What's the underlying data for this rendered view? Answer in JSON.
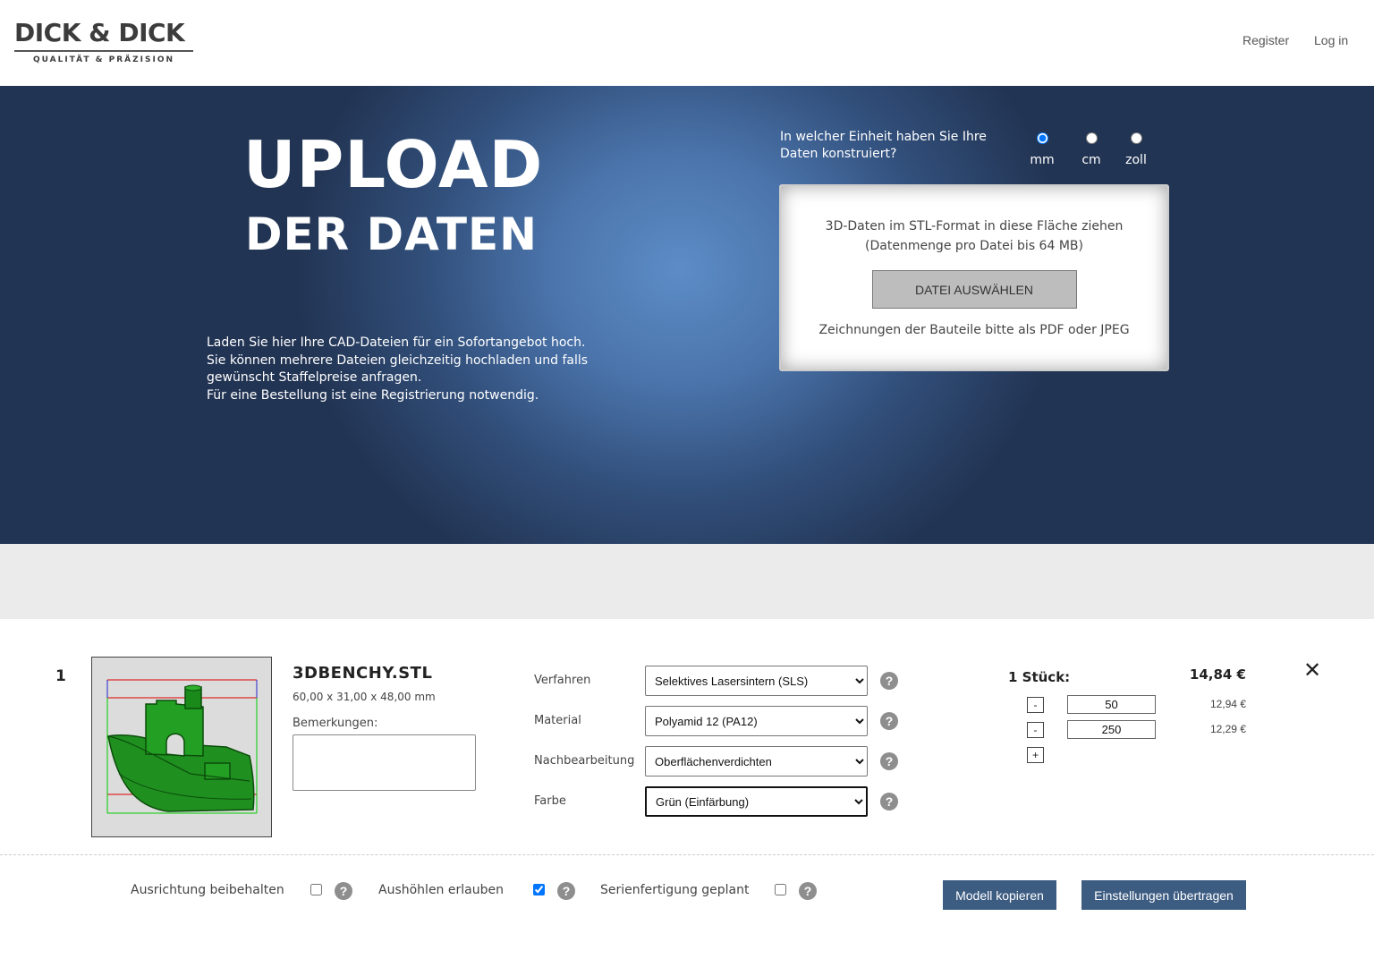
{
  "header": {
    "logo_main": "DICK & DICK",
    "logo_sub": "QUALITÄT & PRÄZISION",
    "nav": {
      "register": "Register",
      "login": "Log in"
    }
  },
  "hero": {
    "title": "UPLOAD",
    "subtitle": "DER DATEN",
    "intro": [
      "Laden Sie hier Ihre CAD-Dateien für ein Sofortangebot hoch.",
      "Sie können mehrere Dateien gleichzeitig hochladen und falls",
      "gewünscht Staffelpreise anfragen.",
      "Für eine Bestellung ist eine Registrierung notwendig."
    ],
    "unit_question": "In welcher Einheit haben Sie Ihre Daten konstruiert?",
    "units": [
      "mm",
      "cm",
      "zoll"
    ],
    "selected_unit": "mm",
    "upload": {
      "line1": "3D-Daten im STL-Format in diese Fläche ziehen",
      "line2": "(Datenmenge pro Datei bis 64 MB)",
      "button": "DATEI AUSWÄHLEN",
      "note": "Zeichnungen der Bauteile bitte als PDF oder JPEG"
    }
  },
  "item": {
    "number": "1",
    "file_name": "3DBENCHY.STL",
    "dimensions": "60,00 x 31,00 x 48,00 mm",
    "remarks_label": "Bemerkungen:",
    "remarks_value": "",
    "options": [
      {
        "label": "Verfahren",
        "value": "Selektives Lasersintern (SLS)",
        "help": "?"
      },
      {
        "label": "Material",
        "value": "Polyamid 12 (PA12)",
        "help": "?"
      },
      {
        "label": "Nachbearbeitung",
        "value": "Oberflächenverdichten",
        "help": "?"
      },
      {
        "label": "Farbe",
        "value": "Grün (Einfärbung)",
        "help": "?"
      }
    ],
    "quantity_label": "1 Stück:",
    "unit_price": "14,84 €",
    "tiers": [
      {
        "remove": "-",
        "qty": "50",
        "price": "12,94 €"
      },
      {
        "remove": "-",
        "qty": "250",
        "price": "12,29 €"
      }
    ],
    "add_tier": "+",
    "close": "✕",
    "model_color": "#1a8a1a"
  },
  "footer_options": {
    "keep_orientation": {
      "label": "Ausrichtung beibehalten",
      "checked": false
    },
    "allow_hollowing": {
      "label": "Aushöhlen erlauben",
      "checked": true
    },
    "series_planned": {
      "label": "Serienfertigung geplant",
      "checked": false
    },
    "help": "?",
    "copy_model": "Modell kopieren",
    "apply_settings": "Einstellungen übertragen"
  },
  "colors": {
    "button_blue": "#3d5c82",
    "hero_dark": "#223453",
    "hero_light": "#5d8cc6"
  }
}
